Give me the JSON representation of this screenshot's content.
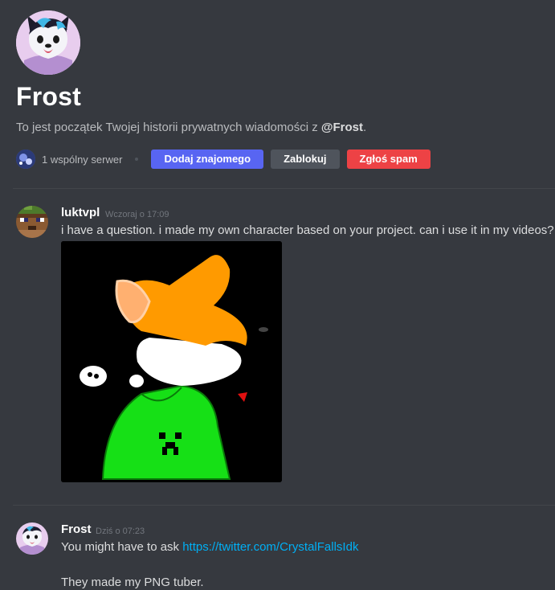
{
  "header": {
    "title": "Frost",
    "intro_prefix": "To jest początek Twojej historii prywatnych wiadomości z ",
    "intro_mention": "@Frost",
    "intro_suffix": "."
  },
  "actions": {
    "mutual_servers": "1 wspólny serwer",
    "add_friend": "Dodaj znajomego",
    "block": "Zablokuj",
    "report_spam": "Zgłoś spam"
  },
  "messages": [
    {
      "username": "luktvpl",
      "timestamp": "Wczoraj o 17:09",
      "text": "i have a question. i made my own character based on your project. can i use it in my videos?"
    },
    {
      "username": "Frost",
      "timestamp": "Dziś o 07:23",
      "text_prefix": "You might have to ask ",
      "link": "https://twitter.com/CrystalFallsIdk",
      "text2": "They made my PNG tuber."
    }
  ],
  "colors": {
    "background": "#36393f",
    "blurple": "#5865f2",
    "danger": "#ed4245",
    "secondary": "#4f545c",
    "link": "#00aff4"
  }
}
